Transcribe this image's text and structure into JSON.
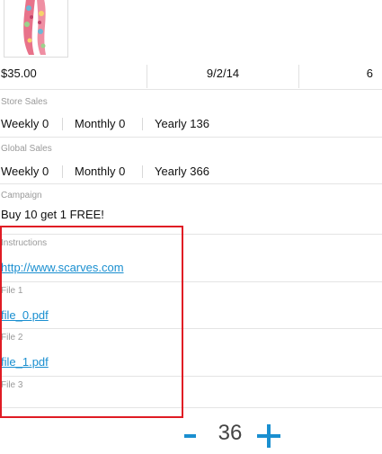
{
  "product": {
    "image_icon": "scarf-product-image",
    "price": "$35.00",
    "date": "9/2/14",
    "count": "6"
  },
  "store_sales": {
    "label": "Store Sales",
    "weekly": "Weekly 0",
    "monthly": "Monthly 0",
    "yearly": "Yearly 136"
  },
  "global_sales": {
    "label": "Global Sales",
    "weekly": "Weekly 0",
    "monthly": "Monthly 0",
    "yearly": "Yearly 366"
  },
  "campaign": {
    "label": "Campaign",
    "value": "Buy 10 get 1 FREE!"
  },
  "instructions": {
    "label": "Instructions",
    "link": "http://www.scarves.com"
  },
  "files": [
    {
      "label": "File 1",
      "link": "file_0.pdf"
    },
    {
      "label": "File 2",
      "link": "file_1.pdf"
    },
    {
      "label": "File 3",
      "link": ""
    }
  ],
  "stepper": {
    "minus_icon": "minus-icon",
    "quantity": "36",
    "plus_icon": "plus-icon"
  },
  "colors": {
    "accent": "#1a8fd0",
    "highlight": "#e01b24",
    "label_gray": "#9a9a9a"
  }
}
